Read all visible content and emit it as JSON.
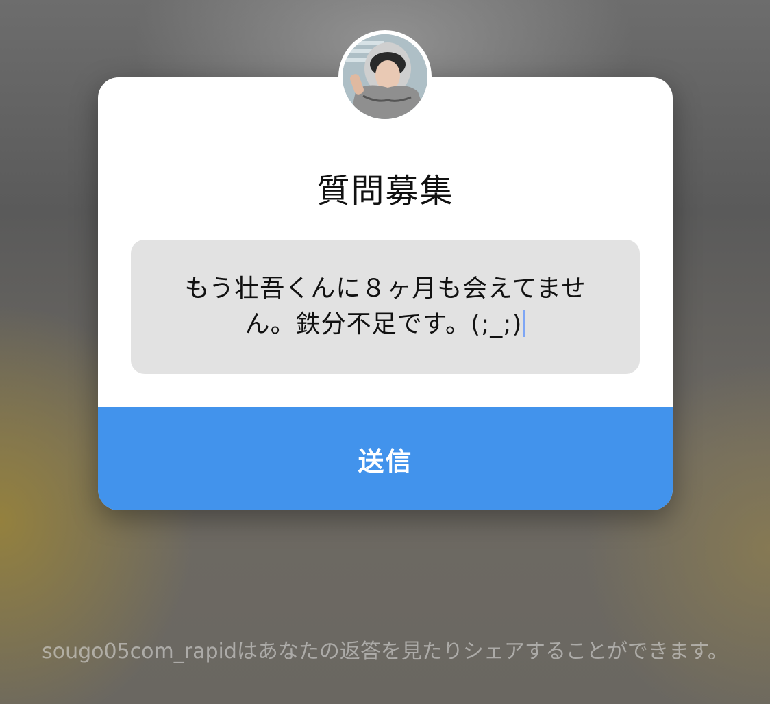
{
  "question_card": {
    "title": "質問募集",
    "answer_text": "もう壮吾くんに８ヶ月も会えてません。鉄分不足です。(;_;)",
    "send_label": "送信"
  },
  "footer": {
    "notice": "sougo05com_rapidはあなたの返答を見たりシェアすることができます。"
  }
}
